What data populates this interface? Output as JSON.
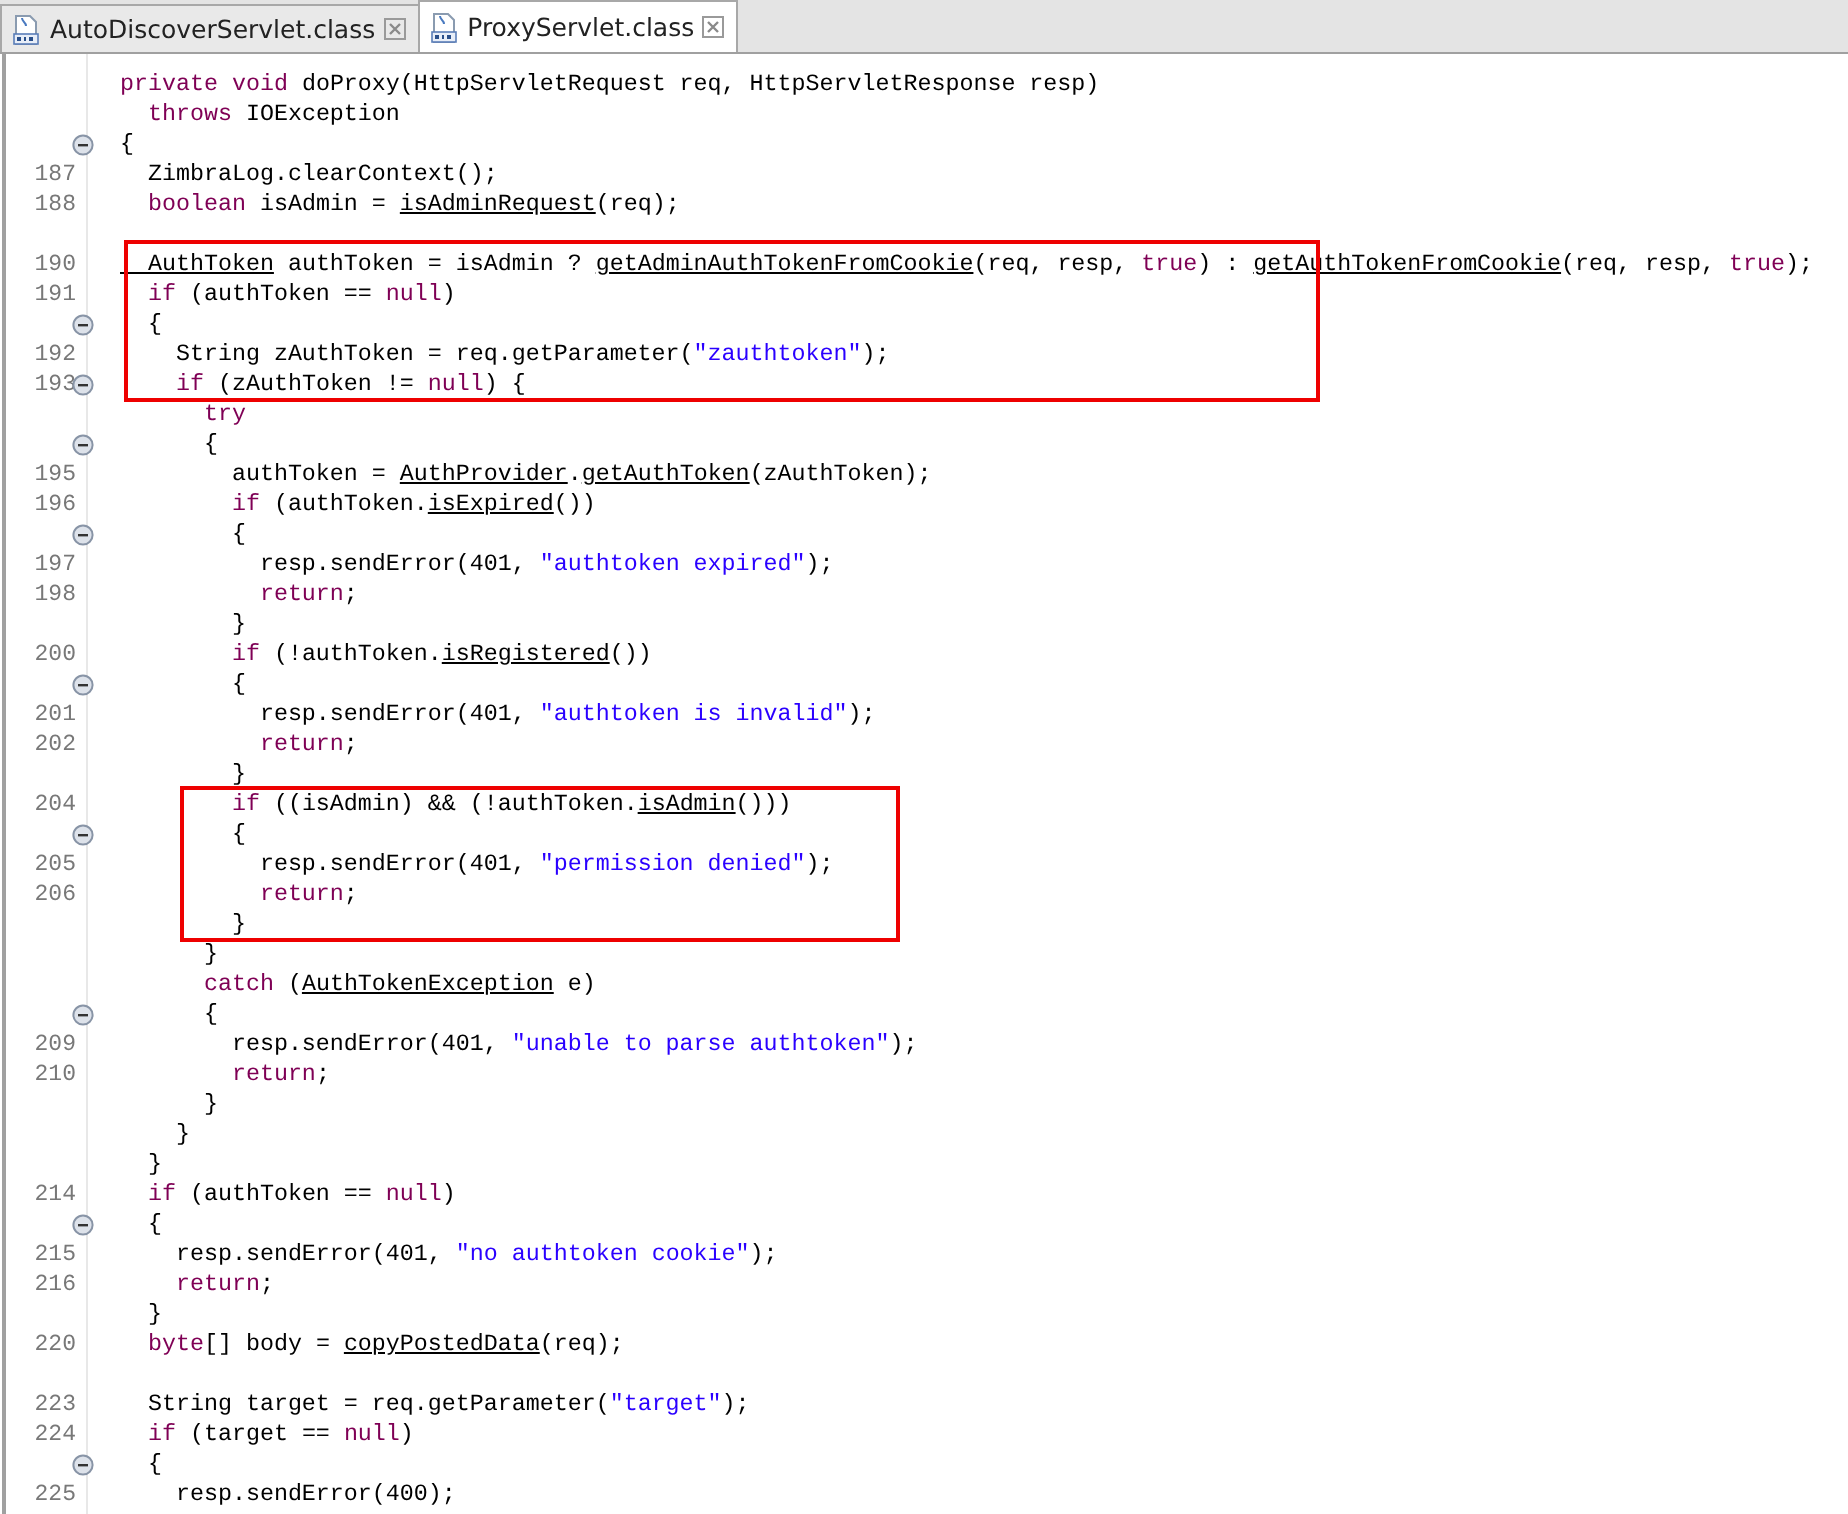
{
  "tabs": [
    {
      "label": "AutoDiscoverServlet.class",
      "selected": false
    },
    {
      "label": "ProxyServlet.class",
      "selected": true
    }
  ],
  "lines": [
    {
      "kind": "code",
      "fold": false,
      "tokens": [
        {
          "kind": "keyword",
          "text": "private void"
        },
        {
          "kind": "plain",
          "text": " doProxy(HttpServletRequest req, HttpServletResponse resp)"
        }
      ]
    },
    {
      "kind": "code",
      "fold": false,
      "tokens": [
        {
          "kind": "keyword",
          "text": "  throws"
        },
        {
          "kind": "plain",
          "text": " IOException"
        }
      ]
    },
    {
      "kind": "code",
      "fold": true,
      "tokens": [
        {
          "kind": "plain",
          "text": "{"
        }
      ]
    },
    {
      "kind": "code",
      "fold": false,
      "number": "187",
      "tokens": [
        {
          "kind": "plain",
          "text": "  ZimbraLog.clearContext();"
        }
      ]
    },
    {
      "kind": "code",
      "fold": false,
      "number": "188",
      "tokens": [
        {
          "kind": "keyword",
          "text": "  boolean"
        },
        {
          "kind": "plain",
          "text": " isAdmin = "
        },
        {
          "kind": "link",
          "text": "isAdminRequest"
        },
        {
          "kind": "plain",
          "text": "(req);"
        }
      ]
    },
    {
      "kind": "blank",
      "fold": false
    },
    {
      "kind": "code",
      "fold": false,
      "number": "190",
      "tokens": [
        {
          "kind": "link",
          "text": "  AuthToken"
        },
        {
          "kind": "plain",
          "text": " authToken = isAdmin ? "
        },
        {
          "kind": "link",
          "text": "getAdminAuthTokenFromCookie"
        },
        {
          "kind": "plain",
          "text": "(req, resp, "
        },
        {
          "kind": "keyword",
          "text": "true"
        },
        {
          "kind": "plain",
          "text": ") : "
        },
        {
          "kind": "link",
          "text": "getAuthTokenFromCookie"
        },
        {
          "kind": "plain",
          "text": "(req, resp, "
        },
        {
          "kind": "keyword",
          "text": "true"
        },
        {
          "kind": "plain",
          "text": ");"
        }
      ]
    },
    {
      "kind": "code",
      "fold": false,
      "number": "191",
      "tokens": [
        {
          "kind": "keyword",
          "text": "  if"
        },
        {
          "kind": "plain",
          "text": " (authToken == "
        },
        {
          "kind": "keyword",
          "text": "null"
        },
        {
          "kind": "plain",
          "text": ")"
        }
      ]
    },
    {
      "kind": "code",
      "fold": true,
      "tokens": [
        {
          "kind": "plain",
          "text": "  {"
        }
      ]
    },
    {
      "kind": "code",
      "fold": false,
      "number": "192",
      "tokens": [
        {
          "kind": "plain",
          "text": "    String zAuthToken = req.getParameter("
        },
        {
          "kind": "string",
          "text": "\"zauthtoken\""
        },
        {
          "kind": "plain",
          "text": ");"
        }
      ]
    },
    {
      "kind": "code",
      "fold": true,
      "number": "193",
      "tokens": [
        {
          "kind": "keyword",
          "text": "    if"
        },
        {
          "kind": "plain",
          "text": " (zAuthToken != "
        },
        {
          "kind": "keyword",
          "text": "null"
        },
        {
          "kind": "plain",
          "text": ") {"
        }
      ]
    },
    {
      "kind": "code",
      "fold": false,
      "tokens": [
        {
          "kind": "keyword",
          "text": "      try"
        }
      ]
    },
    {
      "kind": "code",
      "fold": true,
      "tokens": [
        {
          "kind": "plain",
          "text": "      {"
        }
      ]
    },
    {
      "kind": "code",
      "fold": false,
      "number": "195",
      "tokens": [
        {
          "kind": "plain",
          "text": "        authToken = "
        },
        {
          "kind": "link",
          "text": "AuthProvider"
        },
        {
          "kind": "plain",
          "text": "."
        },
        {
          "kind": "link",
          "text": "getAuthToken"
        },
        {
          "kind": "plain",
          "text": "(zAuthToken);"
        }
      ]
    },
    {
      "kind": "code",
      "fold": false,
      "number": "196",
      "tokens": [
        {
          "kind": "keyword",
          "text": "        if"
        },
        {
          "kind": "plain",
          "text": " (authToken."
        },
        {
          "kind": "link",
          "text": "isExpired"
        },
        {
          "kind": "plain",
          "text": "())"
        }
      ]
    },
    {
      "kind": "code",
      "fold": true,
      "tokens": [
        {
          "kind": "plain",
          "text": "        {"
        }
      ]
    },
    {
      "kind": "code",
      "fold": false,
      "number": "197",
      "tokens": [
        {
          "kind": "plain",
          "text": "          resp.sendError(401, "
        },
        {
          "kind": "string",
          "text": "\"authtoken expired\""
        },
        {
          "kind": "plain",
          "text": ");"
        }
      ]
    },
    {
      "kind": "code",
      "fold": false,
      "number": "198",
      "tokens": [
        {
          "kind": "keyword",
          "text": "          return"
        },
        {
          "kind": "plain",
          "text": ";"
        }
      ]
    },
    {
      "kind": "code",
      "fold": false,
      "tokens": [
        {
          "kind": "plain",
          "text": "        }"
        }
      ]
    },
    {
      "kind": "code",
      "fold": false,
      "number": "200",
      "tokens": [
        {
          "kind": "keyword",
          "text": "        if"
        },
        {
          "kind": "plain",
          "text": " (!authToken."
        },
        {
          "kind": "link",
          "text": "isRegistered"
        },
        {
          "kind": "plain",
          "text": "())"
        }
      ]
    },
    {
      "kind": "code",
      "fold": true,
      "tokens": [
        {
          "kind": "plain",
          "text": "        {"
        }
      ]
    },
    {
      "kind": "code",
      "fold": false,
      "number": "201",
      "tokens": [
        {
          "kind": "plain",
          "text": "          resp.sendError(401, "
        },
        {
          "kind": "string",
          "text": "\"authtoken is invalid\""
        },
        {
          "kind": "plain",
          "text": ");"
        }
      ]
    },
    {
      "kind": "code",
      "fold": false,
      "number": "202",
      "tokens": [
        {
          "kind": "keyword",
          "text": "          return"
        },
        {
          "kind": "plain",
          "text": ";"
        }
      ]
    },
    {
      "kind": "code",
      "fold": false,
      "tokens": [
        {
          "kind": "plain",
          "text": "        }"
        }
      ]
    },
    {
      "kind": "code",
      "fold": false,
      "number": "204",
      "tokens": [
        {
          "kind": "keyword",
          "text": "        if"
        },
        {
          "kind": "plain",
          "text": " ((isAdmin) && (!authToken."
        },
        {
          "kind": "link",
          "text": "isAdmin"
        },
        {
          "kind": "plain",
          "text": "()))"
        }
      ]
    },
    {
      "kind": "code",
      "fold": true,
      "tokens": [
        {
          "kind": "plain",
          "text": "        {"
        }
      ]
    },
    {
      "kind": "code",
      "fold": false,
      "number": "205",
      "tokens": [
        {
          "kind": "plain",
          "text": "          resp.sendError(401, "
        },
        {
          "kind": "string",
          "text": "\"permission denied\""
        },
        {
          "kind": "plain",
          "text": ");"
        }
      ]
    },
    {
      "kind": "code",
      "fold": false,
      "number": "206",
      "tokens": [
        {
          "kind": "keyword",
          "text": "          return"
        },
        {
          "kind": "plain",
          "text": ";"
        }
      ]
    },
    {
      "kind": "code",
      "fold": false,
      "tokens": [
        {
          "kind": "plain",
          "text": "        }"
        }
      ]
    },
    {
      "kind": "code",
      "fold": false,
      "tokens": [
        {
          "kind": "plain",
          "text": "      }"
        }
      ]
    },
    {
      "kind": "code",
      "fold": false,
      "tokens": [
        {
          "kind": "keyword",
          "text": "      catch"
        },
        {
          "kind": "plain",
          "text": " ("
        },
        {
          "kind": "link",
          "text": "AuthTokenException"
        },
        {
          "kind": "plain",
          "text": " e)"
        }
      ]
    },
    {
      "kind": "code",
      "fold": true,
      "tokens": [
        {
          "kind": "plain",
          "text": "      {"
        }
      ]
    },
    {
      "kind": "code",
      "fold": false,
      "number": "209",
      "tokens": [
        {
          "kind": "plain",
          "text": "        resp.sendError(401, "
        },
        {
          "kind": "string",
          "text": "\"unable to parse authtoken\""
        },
        {
          "kind": "plain",
          "text": ");"
        }
      ]
    },
    {
      "kind": "code",
      "fold": false,
      "number": "210",
      "tokens": [
        {
          "kind": "keyword",
          "text": "        return"
        },
        {
          "kind": "plain",
          "text": ";"
        }
      ]
    },
    {
      "kind": "code",
      "fold": false,
      "tokens": [
        {
          "kind": "plain",
          "text": "      }"
        }
      ]
    },
    {
      "kind": "code",
      "fold": false,
      "tokens": [
        {
          "kind": "plain",
          "text": "    }"
        }
      ]
    },
    {
      "kind": "code",
      "fold": false,
      "tokens": [
        {
          "kind": "plain",
          "text": "  }"
        }
      ]
    },
    {
      "kind": "code",
      "fold": false,
      "number": "214",
      "tokens": [
        {
          "kind": "keyword",
          "text": "  if"
        },
        {
          "kind": "plain",
          "text": " (authToken == "
        },
        {
          "kind": "keyword",
          "text": "null"
        },
        {
          "kind": "plain",
          "text": ")"
        }
      ]
    },
    {
      "kind": "code",
      "fold": true,
      "tokens": [
        {
          "kind": "plain",
          "text": "  {"
        }
      ]
    },
    {
      "kind": "code",
      "fold": false,
      "number": "215",
      "tokens": [
        {
          "kind": "plain",
          "text": "    resp.sendError(401, "
        },
        {
          "kind": "string",
          "text": "\"no authtoken cookie\""
        },
        {
          "kind": "plain",
          "text": ");"
        }
      ]
    },
    {
      "kind": "code",
      "fold": false,
      "number": "216",
      "tokens": [
        {
          "kind": "keyword",
          "text": "    return"
        },
        {
          "kind": "plain",
          "text": ";"
        }
      ]
    },
    {
      "kind": "code",
      "fold": false,
      "tokens": [
        {
          "kind": "plain",
          "text": "  }"
        }
      ]
    },
    {
      "kind": "code",
      "fold": false,
      "number": "220",
      "tokens": [
        {
          "kind": "keyword",
          "text": "  byte"
        },
        {
          "kind": "plain",
          "text": "[] body = "
        },
        {
          "kind": "link",
          "text": "copyPostedData"
        },
        {
          "kind": "plain",
          "text": "(req);"
        }
      ]
    },
    {
      "kind": "blank",
      "fold": false
    },
    {
      "kind": "code",
      "fold": false,
      "number": "223",
      "tokens": [
        {
          "kind": "plain",
          "text": "  String target = req.getParameter("
        },
        {
          "kind": "string",
          "text": "\"target\""
        },
        {
          "kind": "plain",
          "text": ");"
        }
      ]
    },
    {
      "kind": "code",
      "fold": false,
      "number": "224",
      "tokens": [
        {
          "kind": "keyword",
          "text": "  if"
        },
        {
          "kind": "plain",
          "text": " (target == "
        },
        {
          "kind": "keyword",
          "text": "null"
        },
        {
          "kind": "plain",
          "text": ")"
        }
      ]
    },
    {
      "kind": "code",
      "fold": true,
      "tokens": [
        {
          "kind": "plain",
          "text": "  {"
        }
      ]
    },
    {
      "kind": "code",
      "fold": false,
      "number": "225",
      "tokens": [
        {
          "kind": "plain",
          "text": "    resp.sendError(400);"
        }
      ]
    }
  ],
  "annotations": [
    {
      "kind": "red-box"
    },
    {
      "kind": "red-box"
    }
  ]
}
